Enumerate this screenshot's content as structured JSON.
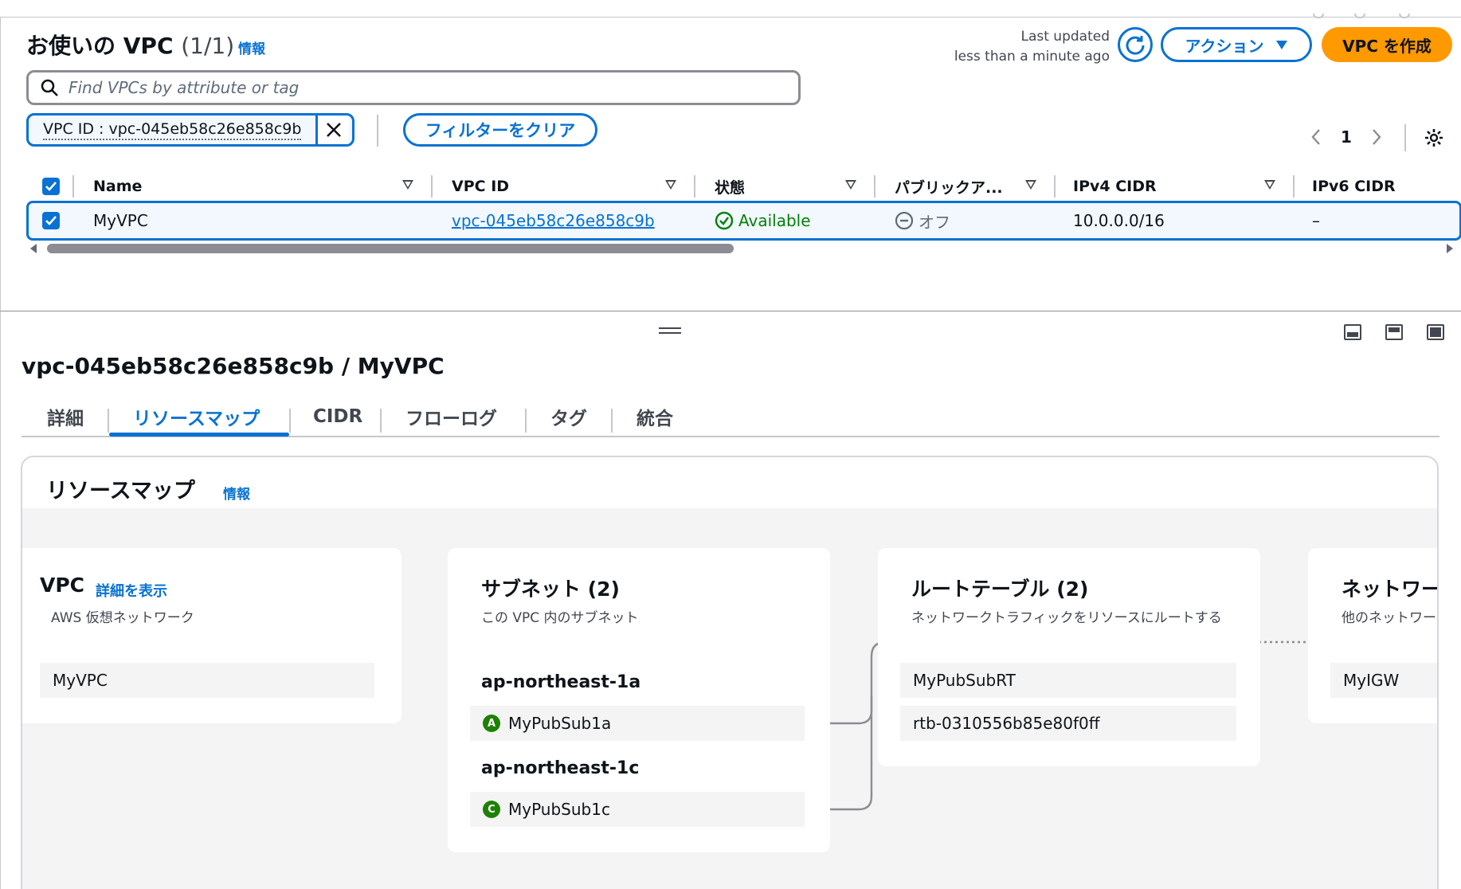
{
  "vpc_list": {
    "title": "お使いの VPC",
    "count": "(1/1)",
    "info": "情報",
    "last_updated_line1": "Last updated",
    "last_updated_line2": "less than a minute ago",
    "actions_label": "アクション",
    "create_label": "VPC を作成",
    "search_placeholder": "Find VPCs by attribute or tag",
    "filter_token": "VPC ID : vpc-045eb58c26e858c9b",
    "clear_filters": "フィルターをクリア",
    "page": "1",
    "columns": [
      "Name",
      "VPC ID",
      "状態",
      "パブリックア...",
      "IPv4 CIDR",
      "IPv6 CIDR"
    ],
    "row": {
      "name": "MyVPC",
      "vpc_id": "vpc-045eb58c26e858c9b",
      "state": "Available",
      "public": "オフ",
      "ipv4": "10.0.0.0/16",
      "ipv6": "–"
    }
  },
  "details": {
    "heading": "vpc-045eb58c26e858c9b / MyVPC",
    "tabs": [
      "詳細",
      "リソースマップ",
      "CIDR",
      "フローログ",
      "タグ",
      "統合"
    ],
    "active_tab": "リソースマップ"
  },
  "resource_map": {
    "title": "リソースマップ",
    "info": "情報",
    "vpc": {
      "title": "VPC",
      "details_link": "詳細を表示",
      "subtitle": "AWS 仮想ネットワーク",
      "item": "MyVPC"
    },
    "subnets": {
      "title": "サブネット (2)",
      "subtitle": "この VPC 内のサブネット",
      "az1": "ap-northeast-1a",
      "az1_badge": "A",
      "subnet1": "MyPubSub1a",
      "az2": "ap-northeast-1c",
      "az2_badge": "C",
      "subnet2": "MyPubSub1c"
    },
    "route_tables": {
      "title": "ルートテーブル (2)",
      "subtitle": "ネットワークトラフィックをリソースにルートする",
      "item1": "MyPubSubRT",
      "item2": "rtb-0310556b85e80f0ff"
    },
    "network": {
      "title": "ネットワーク接続",
      "subtitle": "他のネットワークへの接続",
      "item": "MyIGW"
    }
  },
  "colors": {
    "accent": "#0972d3",
    "primary_button": "#ff9900",
    "success": "#037f0c",
    "az_badge": "#1d8102"
  }
}
